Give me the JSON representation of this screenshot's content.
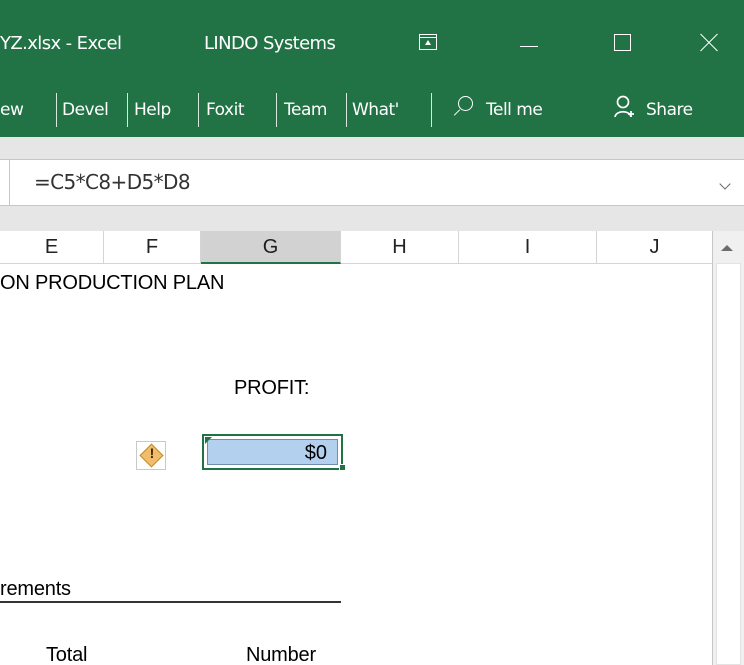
{
  "window": {
    "title": "YZ.xlsx  -  Excel",
    "addin_title": "LINDO Systems"
  },
  "ribbon": {
    "tabs": [
      "ew",
      "Devel",
      "Help",
      "Foxit",
      "Team",
      "What'"
    ],
    "tell_me": "Tell me",
    "share": "Share"
  },
  "formula_bar": {
    "formula": "=C5*C8+D5*D8"
  },
  "columns": [
    "E",
    "F",
    "G",
    "H",
    "I",
    "J"
  ],
  "selected_column": "G",
  "sheet": {
    "heading": "ON PRODUCTION PLAN",
    "profit_label": "PROFIT:",
    "profit_value": "$0",
    "warning_mark": "!",
    "section_label": "rements",
    "col_total": "Total",
    "col_number": "Number"
  },
  "colors": {
    "excel_green": "#217346",
    "selection_fill": "#b3d1ef",
    "warning": "#f2bd6b"
  },
  "icons": {
    "restore_ribbon": "restore-ribbon-icon",
    "minimize": "minimize-icon",
    "maximize": "maximize-icon",
    "close": "close-icon",
    "search": "search-icon",
    "share": "share-icon",
    "warning": "warning-icon",
    "expand": "chevron-down-icon",
    "scroll_up": "scroll-up-icon"
  }
}
